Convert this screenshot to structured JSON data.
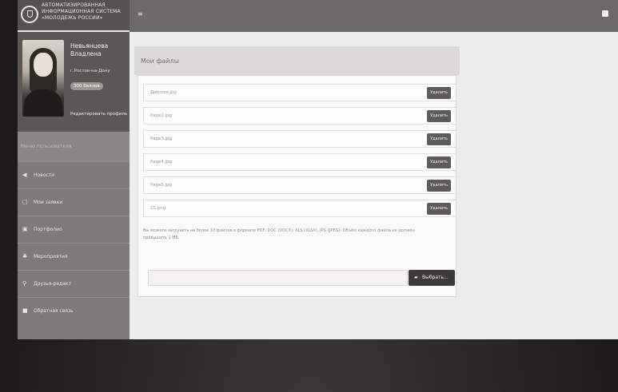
{
  "header": {
    "brand_lines": [
      "АВТОМАТИЗИРОВАННАЯ",
      "ИНФОРМАЦИОННАЯ СИСТЕМА",
      "«МОЛОДЕЖЬ РОССИИ»"
    ],
    "menu_icon": "menu-toggle-icon",
    "user_icon": "user-icon"
  },
  "profile": {
    "name_line1": "Невьянцева",
    "name_line2": "Владлена",
    "city": "г.Ростов-на-Дону",
    "badge": "300 баллов",
    "edit_link": "Редактировать профиль"
  },
  "sidebar": {
    "section_title": "Меню пользователя",
    "items": [
      {
        "label": "Новости",
        "icon": "◀"
      },
      {
        "label": "Мои заявки",
        "icon": "▢"
      },
      {
        "label": "Портфолио",
        "icon": "▣"
      },
      {
        "label": "Мероприятия",
        "icon": "♣"
      },
      {
        "label": "Друзья-редакт",
        "icon": "⚲"
      },
      {
        "label": "Обратная связь",
        "icon": "■"
      }
    ]
  },
  "main": {
    "title": "Мои файлы",
    "files": [
      {
        "name": "Диплом.jpg",
        "action": "Удалить"
      },
      {
        "name": "Page2.jpg",
        "action": "Удалить"
      },
      {
        "name": "Page3.jpg",
        "action": "Удалить"
      },
      {
        "name": "Page4.jpg",
        "action": "Удалить"
      },
      {
        "name": "Page5.jpg",
        "action": "Удалить"
      },
      {
        "name": "15.png",
        "action": "Удалить"
      }
    ],
    "hint_line1": "Вы можете загрузить не более 10 файлов в формате PDF, DOC (DOCX), XLS (XLSX), JPG (JPEG). Объём каждого файла не должен",
    "hint_line2": "превышать 1 МБ.",
    "choose_button": "Выбрать...",
    "choose_icon": "▰"
  },
  "colors": {
    "topbar": "#6c6a66",
    "sidebar": "#7e7c78",
    "button": "#5d5b57"
  }
}
